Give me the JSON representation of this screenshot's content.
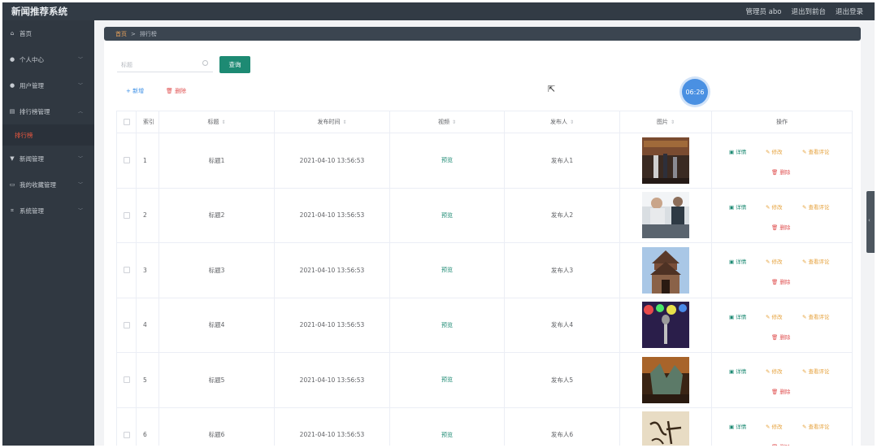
{
  "app": {
    "title": "新闻推荐系统"
  },
  "header": {
    "user": "管理员 abo",
    "to_frontend": "退出到前台",
    "logout": "退出登录"
  },
  "sidebar": {
    "items": [
      {
        "label": "首页",
        "icon": "home-icon"
      },
      {
        "label": "个人中心",
        "icon": "user-icon",
        "expandable": true
      },
      {
        "label": "用户管理",
        "icon": "users-icon",
        "expandable": true
      },
      {
        "label": "排行榜管理",
        "icon": "list-icon",
        "expandable": true,
        "expanded": true
      },
      {
        "label": "新闻管理",
        "icon": "news-icon",
        "expandable": true
      },
      {
        "label": "我的收藏管理",
        "icon": "collection-icon",
        "expandable": true
      },
      {
        "label": "系统管理",
        "icon": "settings-icon",
        "expandable": true
      }
    ],
    "active_sub": "排行榜"
  },
  "breadcrumb": {
    "home": "首页",
    "separator": ">",
    "current": "排行榜"
  },
  "search": {
    "placeholder": "标题",
    "button": "查询"
  },
  "actions": {
    "add": "+ 新增",
    "delete": "删除"
  },
  "table": {
    "headers": {
      "index": "索引",
      "title": "标题",
      "time": "发布时间",
      "video": "视频",
      "publisher": "发布人",
      "image": "图片",
      "ops": "操作"
    },
    "rows": [
      {
        "index": "1",
        "title": "标题1",
        "time": "2021-04-10 13:56:53",
        "video": "预览",
        "publisher": "发布人1"
      },
      {
        "index": "2",
        "title": "标题2",
        "time": "2021-04-10 13:56:53",
        "video": "预览",
        "publisher": "发布人2"
      },
      {
        "index": "3",
        "title": "标题3",
        "time": "2021-04-10 13:56:53",
        "video": "预览",
        "publisher": "发布人3"
      },
      {
        "index": "4",
        "title": "标题4",
        "time": "2021-04-10 13:56:53",
        "video": "预览",
        "publisher": "发布人4"
      },
      {
        "index": "5",
        "title": "标题5",
        "time": "2021-04-10 13:56:53",
        "video": "预览",
        "publisher": "发布人5"
      },
      {
        "index": "6",
        "title": "标题6",
        "time": "2021-04-10 13:56:53",
        "video": "预览",
        "publisher": "发布人6"
      }
    ],
    "op_labels": {
      "detail": "详情",
      "edit": "修改",
      "review": "查看评论",
      "delete": "删除"
    }
  },
  "timer": "06:26",
  "colors": {
    "topbar": "#323b45",
    "sidebar": "#303841",
    "accent": "#1d8a73",
    "danger": "#e05151",
    "warn": "#e6a23c",
    "link": "#3a8ee6"
  }
}
